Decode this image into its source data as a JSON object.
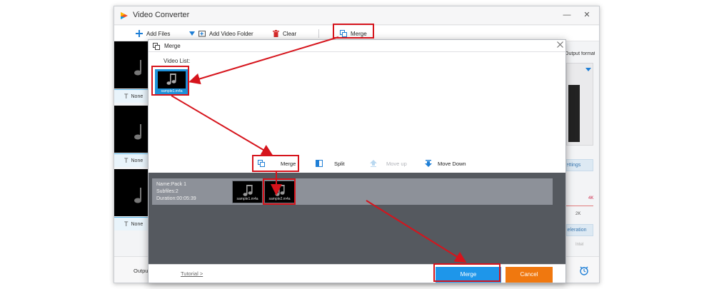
{
  "app": {
    "title": "Video Converter",
    "window_controls": {
      "minimize": "—",
      "maximize": "☐",
      "close": "✕"
    }
  },
  "toolbar": {
    "add_files": "Add Files",
    "add_video_folder": "Add Video Folder",
    "clear": "Clear",
    "merge": "Merge"
  },
  "file_list": {
    "rows": [
      {
        "subtitle_value": "None"
      },
      {
        "subtitle_value": "None"
      },
      {
        "subtitle_value": "None"
      }
    ]
  },
  "right_panel": {
    "output_format_label": "Output format:",
    "settings_label": "Settings",
    "resolution_left": "4K",
    "resolution_mid": "2K",
    "acceleration_label": "Acceleration",
    "intel_label": "Intel"
  },
  "bottom_bar": {
    "output_label": "Output"
  },
  "dialog": {
    "title": "Merge",
    "video_list_label": "Video List:",
    "video_item_name": "sample1.m4a",
    "actions": {
      "merge": "Merge",
      "split": "Split",
      "move_up": "Move up",
      "move_down": "Move Down"
    },
    "pack": {
      "name": "Name:Pack 1",
      "subfiles": "Subfiles:2",
      "duration": "Duration:00:05:39",
      "items": [
        "sample1.m4a",
        "sample2.m4a"
      ]
    },
    "footer": {
      "tutorial": "Tutorial >",
      "merge_button": "Merge",
      "cancel_button": "Cancel"
    }
  },
  "colors": {
    "accent_blue": "#1e96ea",
    "cancel_orange": "#f0780f",
    "annotation_red": "#d6141c",
    "pack_area": "#55595f"
  },
  "icons": [
    "app-logo-icon",
    "plus-icon",
    "folder-icon",
    "trash-icon",
    "merge-icon",
    "split-icon",
    "move-up-icon",
    "move-down-icon",
    "music-note-icon",
    "close-icon",
    "subtitle-icon",
    "alarm-clock-icon"
  ]
}
